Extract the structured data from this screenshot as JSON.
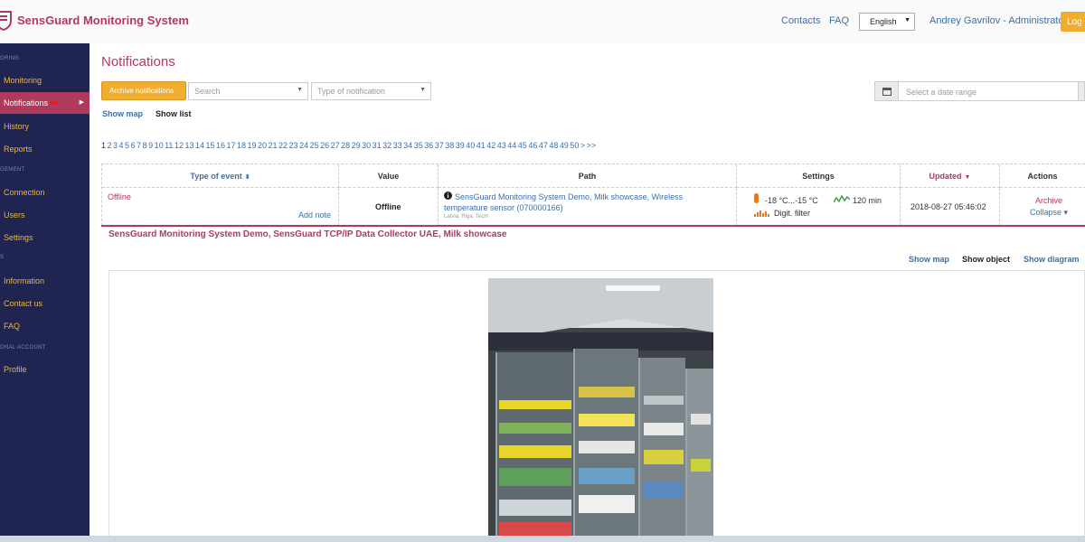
{
  "header": {
    "app_title": "SensGuard Monitoring System",
    "contacts": "Contacts",
    "faq": "FAQ",
    "language": "English",
    "user": "Andrey Gavrilov - Administrator",
    "logout": "Log o"
  },
  "sidebar": {
    "section_monitoring": "ORING",
    "section_management": "GEMENT",
    "section_info": "S",
    "section_personal": "ONAL ACCOUNT",
    "items": [
      {
        "label": "Monitoring"
      },
      {
        "label": "Notifications"
      },
      {
        "label": "History"
      },
      {
        "label": "Reports"
      },
      {
        "label": "Connection"
      },
      {
        "label": "Users"
      },
      {
        "label": "Settings"
      },
      {
        "label": "Information"
      },
      {
        "label": "Contact us"
      },
      {
        "label": "FAQ"
      },
      {
        "label": "Profile"
      }
    ]
  },
  "main": {
    "title": "Notifications",
    "archive_button": "Archive notifications",
    "search_placeholder": "Search",
    "type_placeholder": "Type of notification",
    "date_placeholder": "Select a date range",
    "show_map": "Show map",
    "show_list": "Show list",
    "pager_current": "1",
    "pager_pages": "2 3 4 5 6 7 8 9 10 11 12 13 14 15 16 17 18 19 20 21 22 23 24 25 26 27 28 29 30 31 32 33 34 35 36 37 38 39 40 41 42 43 44 45 46 47 48 49 50 > >>"
  },
  "table": {
    "headers": {
      "type": "Type of event",
      "value": "Value",
      "path": "Path",
      "settings": "Settings",
      "updated": "Updated",
      "actions": "Actions"
    },
    "row": {
      "type": "Offline",
      "add_note": "Add note",
      "value": "Offline",
      "path_link": "SensGuard Monitoring System Demo, Milk showcase, Wireless temperature sensor (070000166)",
      "path_location": "Latvia, Riga, Tecm",
      "range": "-18 °C...-15 °C",
      "interval": "120 min",
      "filter": "Digit. filter",
      "updated": "2018-08-27 05:46:02",
      "archive": "Archive",
      "collapse": "Collapse ▾"
    }
  },
  "detail": {
    "title": "SensGuard Monitoring System Demo, SensGuard TCP/IP Data Collector UAE, Milk showcase",
    "show_map": "Show map",
    "show_object": "Show object",
    "show_diagram": "Show diagram"
  },
  "colors": {
    "brand": "#b03a5b",
    "sidebar_bg": "#1f2451",
    "accent": "#f0ad2e",
    "link": "#3b6fa8"
  }
}
